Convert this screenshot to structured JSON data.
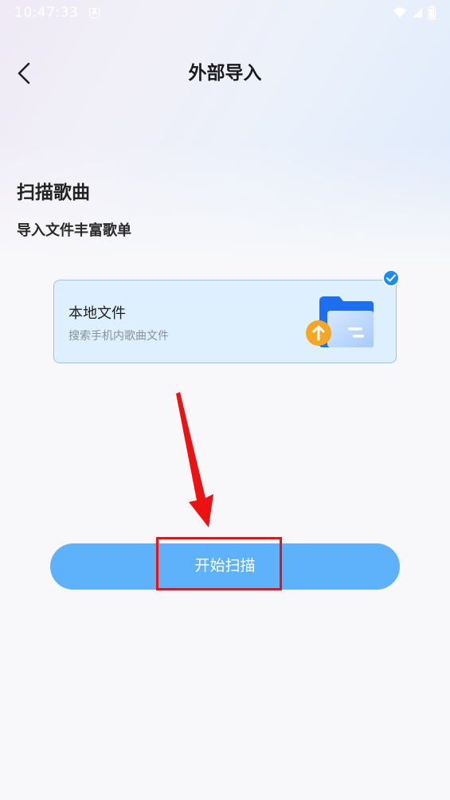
{
  "status_bar": {
    "time": "10:47:33",
    "badge": "A"
  },
  "header": {
    "title": "外部导入"
  },
  "section": {
    "title": "扫描歌曲",
    "subtitle": "导入文件丰富歌单"
  },
  "source_card": {
    "title": "本地文件",
    "description": "搜索手机内歌曲文件",
    "selected": true
  },
  "actions": {
    "start_label": "开始扫描"
  },
  "colors": {
    "accent": "#1c8cf5",
    "button": "#5eb2fb",
    "card_bg": "#def0fd",
    "annotation": "#ee1111"
  },
  "icons": [
    "back-arrow-icon",
    "wifi-icon",
    "signal-icon",
    "battery-icon",
    "checkmark-icon",
    "folder-upload-icon"
  ]
}
